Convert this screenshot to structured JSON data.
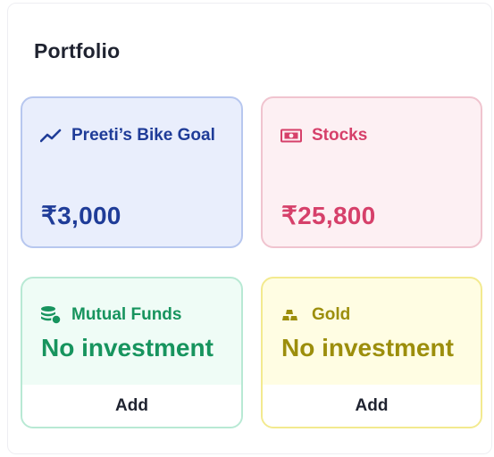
{
  "portfolio": {
    "title": "Portfolio",
    "cards": {
      "goal": {
        "icon": "trend-up-icon",
        "label": "Preeti’s Bike Goal",
        "amount": "₹3,000",
        "color": "#1f3c98"
      },
      "stocks": {
        "icon": "banknote-icon",
        "label": "Stocks",
        "amount": "₹25,800",
        "color": "#d6406a"
      },
      "mutual_funds": {
        "icon": "coins-stack-icon",
        "label": "Mutual Funds",
        "status": "No investment",
        "action": "Add",
        "color": "#17945e"
      },
      "gold": {
        "icon": "gold-bars-icon",
        "label": "Gold",
        "status": "No investment",
        "action": "Add",
        "color": "#9c8e0c"
      }
    }
  }
}
